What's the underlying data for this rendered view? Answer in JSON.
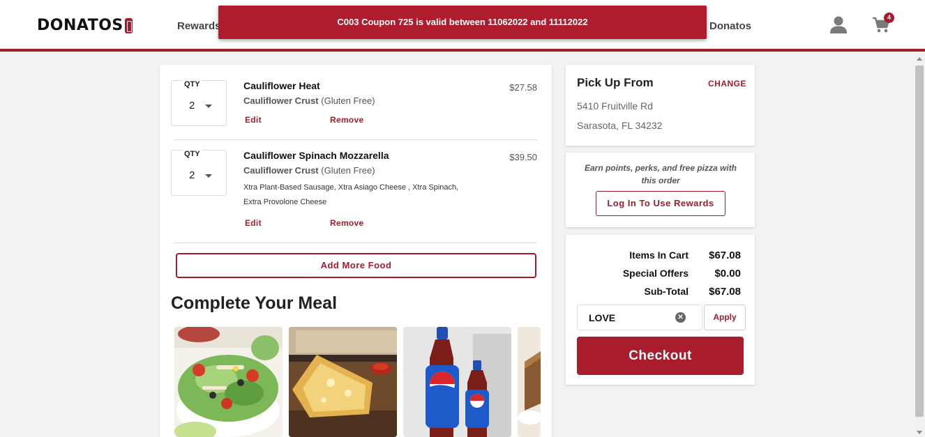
{
  "header": {
    "logo": "DONATOS",
    "logo_badge": "PIZZA",
    "nav_rewards": "Rewards",
    "nav_donatos": "Donatos",
    "cart_count": "4"
  },
  "toast": {
    "message": "C003 Coupon 725 is valid between 11062022 and 11112022"
  },
  "cart": {
    "items": [
      {
        "qty_label": "QTY",
        "qty": "2",
        "name": "Cauliflower Heat",
        "crust": "Cauliflower Crust",
        "crust_note": "(Gluten Free)",
        "toppings": "",
        "price": "$27.58",
        "edit": "Edit",
        "remove": "Remove"
      },
      {
        "qty_label": "QTY",
        "qty": "2",
        "name": "Cauliflower Spinach Mozzarella",
        "crust": "Cauliflower Crust",
        "crust_note": "(Gluten Free)",
        "toppings": "Xtra Plant-Based Sausage, Xtra Asiago Cheese , Xtra Spinach, Extra Provolone Cheese",
        "price": "$39.50",
        "edit": "Edit",
        "remove": "Remove"
      }
    ],
    "add_more": "Add More Food",
    "complete_title": "Complete Your Meal",
    "meal_cards": [
      "salad-image",
      "breadsticks-image",
      "pepsi-image",
      "dessert-image"
    ]
  },
  "pickup": {
    "title": "Pick Up From",
    "change": "CHANGE",
    "address_line1": "5410 Fruitville Rd",
    "address_line2": "Sarasota, FL 34232"
  },
  "rewards": {
    "text": "Earn points, perks, and free pizza with this order",
    "login_button": "Log In To Use Rewards"
  },
  "summary": {
    "items_label": "Items In Cart",
    "items_value": "$67.08",
    "offers_label": "Special Offers",
    "offers_value": "$0.00",
    "subtotal_label": "Sub-Total",
    "subtotal_value": "$67.08",
    "promo_value": "LOVE",
    "apply": "Apply",
    "checkout": "Checkout"
  },
  "colors": {
    "brand": "#a31c2c",
    "background": "#f2f2f2"
  }
}
